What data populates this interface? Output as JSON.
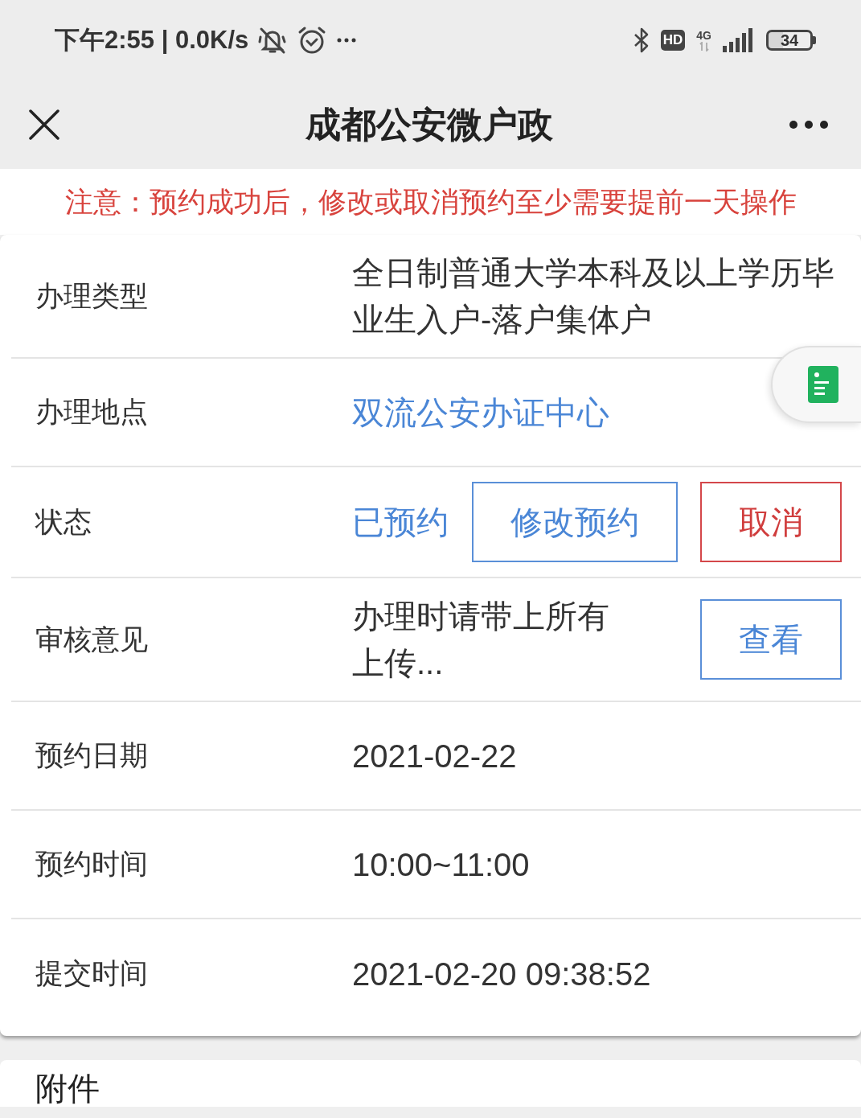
{
  "status_bar": {
    "time_speed": "下午2:55 | 0.0K/s",
    "hd": "HD",
    "network": "4G",
    "battery": "34"
  },
  "nav": {
    "title": "成都公安微户政"
  },
  "notice": "注意：预约成功后，修改或取消预约至少需要提前一天操作",
  "details": [
    {
      "label": "办理类型",
      "kind": "text",
      "value": "全日制普通大学本科及以上学历毕业生入户-落户集体户"
    },
    {
      "label": "办理地点",
      "kind": "link",
      "value": "双流公安办证中心"
    },
    {
      "label": "状态",
      "kind": "status",
      "value": "已预约",
      "buttons": [
        {
          "label": "修改预约",
          "kind": "primary"
        },
        {
          "label": "取消",
          "kind": "danger"
        }
      ]
    },
    {
      "label": "审核意见",
      "kind": "text",
      "value": "办理时请带上所有上传...",
      "buttons": [
        {
          "label": "查看",
          "kind": "primary"
        }
      ]
    },
    {
      "label": "预约日期",
      "kind": "text",
      "value": "2021-02-22"
    },
    {
      "label": "预约时间",
      "kind": "text",
      "value": "10:00~11:00"
    },
    {
      "label": "提交时间",
      "kind": "text",
      "value": "2021-02-20 09:38:52"
    }
  ],
  "attachments": {
    "title": "附件"
  }
}
